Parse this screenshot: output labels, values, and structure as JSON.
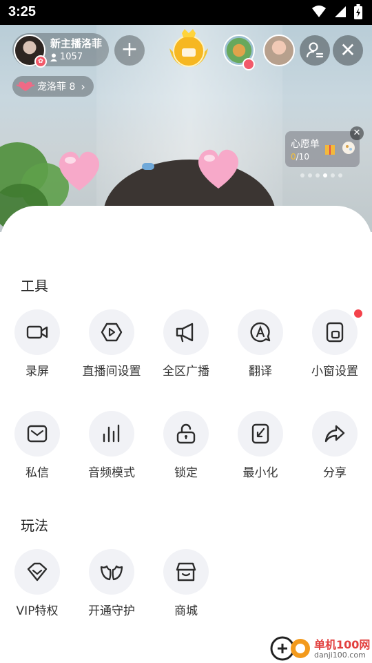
{
  "status_bar": {
    "time": "3:25"
  },
  "host": {
    "name": "新主播洛菲",
    "count": "1057"
  },
  "fans_club": {
    "label": "宠洛菲 8"
  },
  "wish_list": {
    "title": "心愿单",
    "current": "0",
    "total": "/10"
  },
  "sections": {
    "tools_title": "工具",
    "play_title": "玩法"
  },
  "tools": [
    {
      "label": "录屏",
      "icon": "video-camera-icon"
    },
    {
      "label": "直播间设置",
      "icon": "live-settings-icon"
    },
    {
      "label": "全区广播",
      "icon": "megaphone-icon"
    },
    {
      "label": "翻译",
      "icon": "translate-icon"
    },
    {
      "label": "小窗设置",
      "icon": "mini-window-icon",
      "badge": true
    },
    {
      "label": "私信",
      "icon": "mail-icon"
    },
    {
      "label": "音频模式",
      "icon": "audio-bars-icon"
    },
    {
      "label": "锁定",
      "icon": "lock-icon"
    },
    {
      "label": "最小化",
      "icon": "minimize-icon"
    },
    {
      "label": "分享",
      "icon": "share-icon"
    }
  ],
  "play": [
    {
      "label": "VIP特权",
      "icon": "vip-diamond-icon"
    },
    {
      "label": "开通守护",
      "icon": "guard-wings-icon"
    },
    {
      "label": "商城",
      "icon": "shop-icon"
    }
  ],
  "watermark": {
    "line1": "单机100网",
    "line2": "danji100.com"
  },
  "colors": {
    "accent_red": "#f4424b",
    "icon_bg": "#f1f2f6",
    "icon_stroke": "#2b2b2b"
  }
}
